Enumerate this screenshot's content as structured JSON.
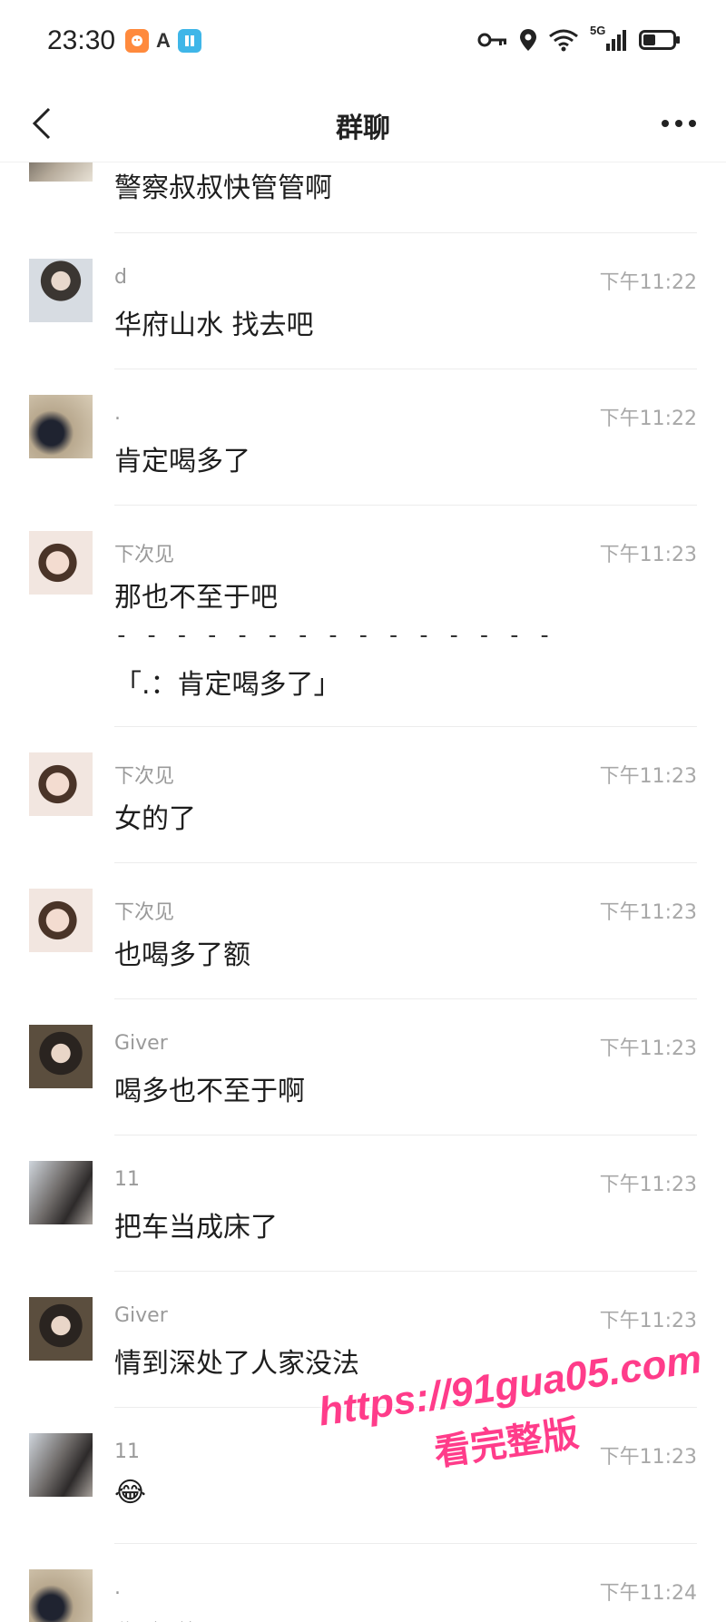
{
  "status": {
    "time": "23:30",
    "network": "5G"
  },
  "nav": {
    "title": "群聊"
  },
  "messages": [
    {
      "sender": "",
      "time": "",
      "text": "警察叔叔快管管啊"
    },
    {
      "sender": "d",
      "time": "下午11:22",
      "text": "华府山水 找去吧"
    },
    {
      "sender": ".",
      "time": "下午11:22",
      "text": "肯定喝多了"
    },
    {
      "sender": "下次见",
      "time": "下午11:23",
      "text": "那也不至于吧",
      "separator": "- - - - - - - - - - - - - - -",
      "quote": "「.：肯定喝多了」"
    },
    {
      "sender": "下次见",
      "time": "下午11:23",
      "text": "女的了"
    },
    {
      "sender": "下次见",
      "time": "下午11:23",
      "text": "也喝多了额"
    },
    {
      "sender": "Giver",
      "time": "下午11:23",
      "text": "喝多也不至于啊"
    },
    {
      "sender": "11",
      "time": "下午11:23",
      "text": "把车当成床了"
    },
    {
      "sender": "Giver",
      "time": "下午11:23",
      "text": "情到深处了人家没法"
    },
    {
      "sender": "11",
      "time": "下午11:23",
      "text": "😂"
    },
    {
      "sender": ".",
      "time": "下午11:24",
      "text": "你会说"
    }
  ],
  "watermark": {
    "url": "https://91gua05.com",
    "subtitle": "看完整版"
  },
  "colors": {
    "accent": "#ff3c8a",
    "time_gray": "#a8a8a8",
    "divider": "#ececec"
  }
}
